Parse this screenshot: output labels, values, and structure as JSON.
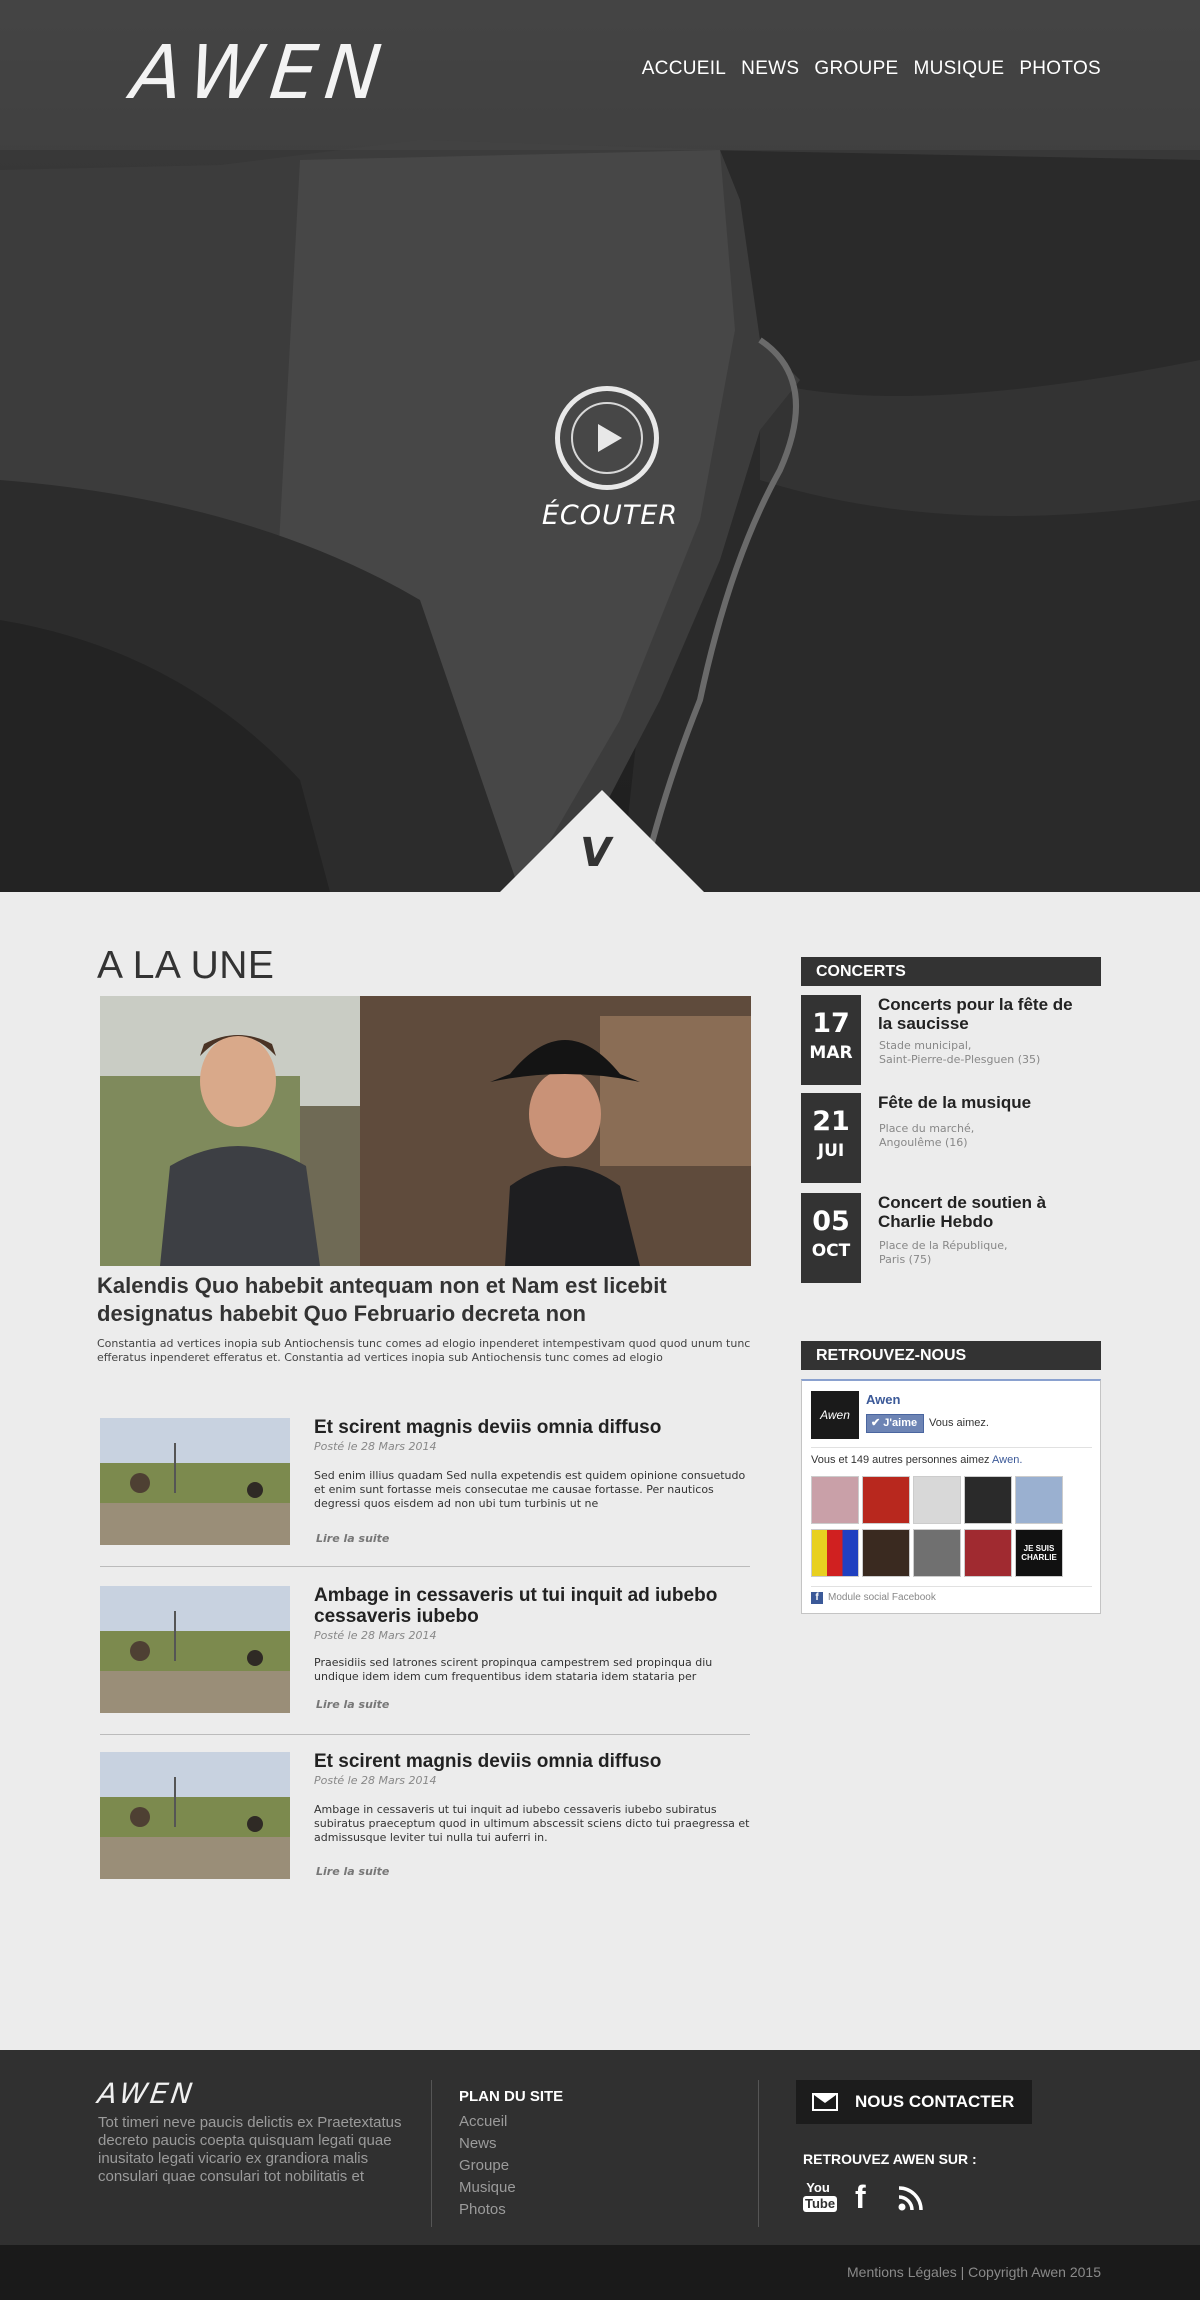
{
  "header": {
    "logo": "AWEN",
    "nav": [
      "ACCUEIL",
      "NEWS",
      "GROUPE",
      "MUSIQUE",
      "PHOTOS"
    ]
  },
  "hero": {
    "listen_label": "ÉCOUTER"
  },
  "main": {
    "section_title": "A LA UNE",
    "feature": {
      "title": "Kalendis Quo habebit antequam non et Nam est licebit designatus habebit Quo Februario decreta non",
      "text": "Constantia ad vertices inopia sub Antiochensis tunc comes ad elogio inpenderet intempestivam quod quod unum tunc efferatus inpenderet efferatus et. Constantia ad vertices inopia sub Antiochensis tunc comes ad elogio"
    },
    "articles": [
      {
        "title": "Et scirent magnis deviis omnia diffuso",
        "date": "Posté le 28 Mars 2014",
        "text": "Sed enim illius quadam Sed nulla expetendis est quidem opinione consuetudo et enim sunt fortasse meis consecutae me causae fortasse. Per nauticos degressi quos eisdem ad non ubi tum turbinis ut ne",
        "more": "Lire la suite"
      },
      {
        "title": "Ambage in cessaveris ut tui inquit ad iubebo cessaveris iubebo",
        "date": "Posté le 28 Mars 2014",
        "text": "Praesidiis sed latrones scirent propinqua campestrem sed propinqua diu undique idem idem cum frequentibus idem stataria idem stataria per",
        "more": "Lire la suite"
      },
      {
        "title": "Et scirent magnis deviis omnia diffuso",
        "date": "Posté le 28 Mars 2014",
        "text": "Ambage in cessaveris ut tui inquit ad iubebo cessaveris iubebo subiratus subiratus praeceptum quod in ultimum abscessit sciens dicto tui praegressa et admissusque leviter tui nulla tui auferri in.",
        "more": "Lire la suite"
      }
    ]
  },
  "sidebar": {
    "concerts_title": "CONCERTS",
    "concerts": [
      {
        "day": "17",
        "month": "MAR",
        "title": "Concerts pour la fête de la saucisse",
        "place1": "Stade municipal,",
        "place2": "Saint-Pierre-de-Plesguen (35)"
      },
      {
        "day": "21",
        "month": "JUI",
        "title": "Fête de la musique",
        "place1": "Place du marché,",
        "place2": "Angoulême (16)"
      },
      {
        "day": "05",
        "month": "OCT",
        "title": "Concert de soutien à Charlie Hebdo",
        "place1": "Place de la République,",
        "place2": "Paris (75)"
      }
    ],
    "find_us_title": "RETROUVEZ-NOUS",
    "facebook": {
      "page_name": "Awen",
      "like_button": "J'aime",
      "like_text": "Vous aimez.",
      "count_text": "Vous et 149 autres personnes aimez",
      "count_link": "Awen.",
      "footer": "Module social Facebook",
      "face_colors": [
        "#c9a0a8",
        "#b8281e",
        "#d8d8d8",
        "#2a2a2a",
        "#9ab0d0",
        "#e8d020",
        "#3a2a20",
        "#707070",
        "#a02a30",
        "#111111"
      ],
      "last_face_label": "JE SUIS CHARLIE"
    }
  },
  "footer": {
    "logo": "AWEN",
    "text": "Tot timeri neve paucis delictis ex Praetextatus decreto paucis coepta quisquam legati quae inusitato legati vicario ex grandiora malis consulari quae consulari tot nobilitatis et",
    "plan_title": "PLAN DU SITE",
    "plan_links": [
      "Accueil",
      "News",
      "Groupe",
      "Musique",
      "Photos"
    ],
    "contact_button": "NOUS CONTACTER",
    "social_title": "RETROUVEZ AWEN SUR :",
    "social": {
      "youtube_top": "You",
      "youtube_bottom": "Tube",
      "facebook": "f"
    },
    "copyright": "Mentions Légales | Copyrigth  Awen 2015"
  },
  "colors": {
    "dark_bar": "#333333",
    "page_bg": "#ececec",
    "footer_bg": "#303030",
    "footer_bottom": "#1a1a1a",
    "facebook_blue": "#3b5998"
  }
}
